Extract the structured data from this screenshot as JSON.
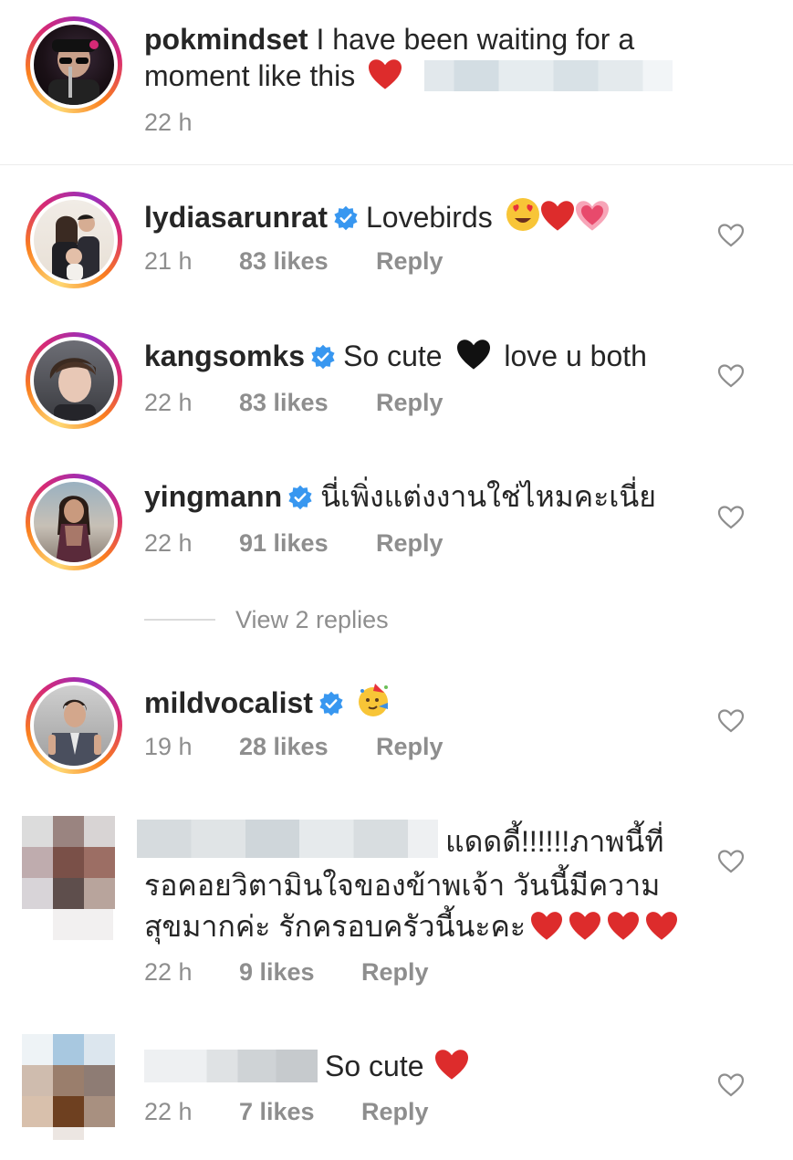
{
  "comments": [
    {
      "username": "pokmindset",
      "text": "I have been waiting for a",
      "text2": "moment like this",
      "time": "22 h"
    },
    {
      "username": "lydiasarunrat",
      "text": "Lovebirds",
      "time": "21 h",
      "likes": "83 likes",
      "reply": "Reply"
    },
    {
      "username": "kangsomks",
      "text": "So cute",
      "text_after": "love u both",
      "time": "22 h",
      "likes": "83 likes",
      "reply": "Reply"
    },
    {
      "username": "yingmann",
      "text": "นี่เพิ่งแต่งงานใช่ไหมคะเนี่ย",
      "time": "22 h",
      "likes": "91 likes",
      "reply": "Reply"
    },
    {
      "username": "mildvocalist",
      "time": "19 h",
      "likes": "28 likes",
      "reply": "Reply"
    },
    {
      "text_line1": "แดดดี้!!!!!!ภาพนี้ที่",
      "text_line2": "รอคอยวิตามินใจของข้าพเจ้า วันนี้มีความ",
      "text_line3": "สุขมากค่ะ รักครอบครัวนี้นะคะ",
      "time": "22 h",
      "likes": "9 likes",
      "reply": "Reply"
    },
    {
      "text": "So cute",
      "time": "22 h",
      "likes": "7 likes",
      "reply": "Reply"
    }
  ],
  "view_replies": "View 2 replies",
  "colors": {
    "text": "#262626",
    "secondary": "#8e8e8e",
    "verified": "#3897f0",
    "heart_red": "#ed1c24"
  }
}
